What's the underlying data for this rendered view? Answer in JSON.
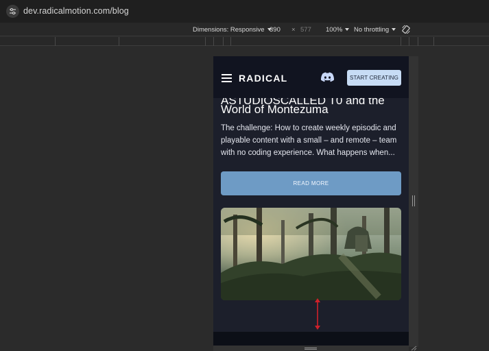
{
  "browser": {
    "url": "dev.radicalmotion.com/blog"
  },
  "device_toolbar": {
    "dimensions_label": "Dimensions: Responsive",
    "width": "390",
    "separator": "×",
    "height": "577",
    "zoom": "100%",
    "throttling": "No throttling"
  },
  "site": {
    "logo": "RADICAL",
    "cta": "START CREATING"
  },
  "post": {
    "title_cut": "ASTUDIOSCALLED T0 and the",
    "title": "World of Montezuma",
    "excerpt": "The challenge: How to create weekly episodic and playable content with a small – and remote – team with no coding experience. What happens when...",
    "read_more": "READ MORE"
  },
  "colors": {
    "site_bg": "#1c1f2b",
    "header_bg": "#111420",
    "cta_bg": "#c7dcf5",
    "read_more_bg": "#6e9bc5",
    "annotation_arrow": "#d0202a"
  },
  "icons": [
    "tune-icon",
    "caret-down-icon",
    "rotate-icon",
    "menu-icon",
    "discord-icon",
    "resize-grip-icon",
    "double-arrow-icon"
  ]
}
